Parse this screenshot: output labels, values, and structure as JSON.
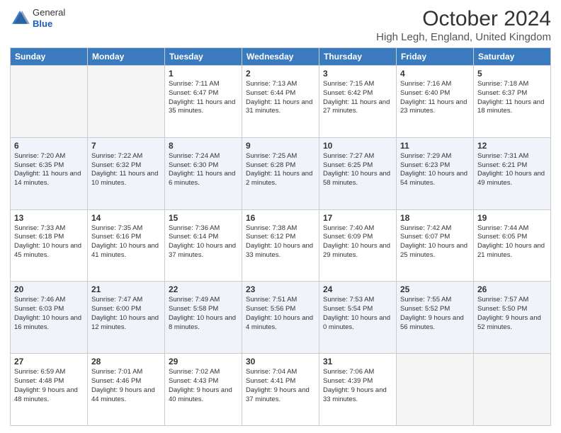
{
  "header": {
    "logo": {
      "general": "General",
      "blue": "Blue"
    },
    "title": "October 2024",
    "subtitle": "High Legh, England, United Kingdom"
  },
  "weekdays": [
    "Sunday",
    "Monday",
    "Tuesday",
    "Wednesday",
    "Thursday",
    "Friday",
    "Saturday"
  ],
  "weeks": [
    [
      {
        "day": "",
        "sunrise": "",
        "sunset": "",
        "daylight": ""
      },
      {
        "day": "",
        "sunrise": "",
        "sunset": "",
        "daylight": ""
      },
      {
        "day": "1",
        "sunrise": "Sunrise: 7:11 AM",
        "sunset": "Sunset: 6:47 PM",
        "daylight": "Daylight: 11 hours and 35 minutes."
      },
      {
        "day": "2",
        "sunrise": "Sunrise: 7:13 AM",
        "sunset": "Sunset: 6:44 PM",
        "daylight": "Daylight: 11 hours and 31 minutes."
      },
      {
        "day": "3",
        "sunrise": "Sunrise: 7:15 AM",
        "sunset": "Sunset: 6:42 PM",
        "daylight": "Daylight: 11 hours and 27 minutes."
      },
      {
        "day": "4",
        "sunrise": "Sunrise: 7:16 AM",
        "sunset": "Sunset: 6:40 PM",
        "daylight": "Daylight: 11 hours and 23 minutes."
      },
      {
        "day": "5",
        "sunrise": "Sunrise: 7:18 AM",
        "sunset": "Sunset: 6:37 PM",
        "daylight": "Daylight: 11 hours and 18 minutes."
      }
    ],
    [
      {
        "day": "6",
        "sunrise": "Sunrise: 7:20 AM",
        "sunset": "Sunset: 6:35 PM",
        "daylight": "Daylight: 11 hours and 14 minutes."
      },
      {
        "day": "7",
        "sunrise": "Sunrise: 7:22 AM",
        "sunset": "Sunset: 6:32 PM",
        "daylight": "Daylight: 11 hours and 10 minutes."
      },
      {
        "day": "8",
        "sunrise": "Sunrise: 7:24 AM",
        "sunset": "Sunset: 6:30 PM",
        "daylight": "Daylight: 11 hours and 6 minutes."
      },
      {
        "day": "9",
        "sunrise": "Sunrise: 7:25 AM",
        "sunset": "Sunset: 6:28 PM",
        "daylight": "Daylight: 11 hours and 2 minutes."
      },
      {
        "day": "10",
        "sunrise": "Sunrise: 7:27 AM",
        "sunset": "Sunset: 6:25 PM",
        "daylight": "Daylight: 10 hours and 58 minutes."
      },
      {
        "day": "11",
        "sunrise": "Sunrise: 7:29 AM",
        "sunset": "Sunset: 6:23 PM",
        "daylight": "Daylight: 10 hours and 54 minutes."
      },
      {
        "day": "12",
        "sunrise": "Sunrise: 7:31 AM",
        "sunset": "Sunset: 6:21 PM",
        "daylight": "Daylight: 10 hours and 49 minutes."
      }
    ],
    [
      {
        "day": "13",
        "sunrise": "Sunrise: 7:33 AM",
        "sunset": "Sunset: 6:18 PM",
        "daylight": "Daylight: 10 hours and 45 minutes."
      },
      {
        "day": "14",
        "sunrise": "Sunrise: 7:35 AM",
        "sunset": "Sunset: 6:16 PM",
        "daylight": "Daylight: 10 hours and 41 minutes."
      },
      {
        "day": "15",
        "sunrise": "Sunrise: 7:36 AM",
        "sunset": "Sunset: 6:14 PM",
        "daylight": "Daylight: 10 hours and 37 minutes."
      },
      {
        "day": "16",
        "sunrise": "Sunrise: 7:38 AM",
        "sunset": "Sunset: 6:12 PM",
        "daylight": "Daylight: 10 hours and 33 minutes."
      },
      {
        "day": "17",
        "sunrise": "Sunrise: 7:40 AM",
        "sunset": "Sunset: 6:09 PM",
        "daylight": "Daylight: 10 hours and 29 minutes."
      },
      {
        "day": "18",
        "sunrise": "Sunrise: 7:42 AM",
        "sunset": "Sunset: 6:07 PM",
        "daylight": "Daylight: 10 hours and 25 minutes."
      },
      {
        "day": "19",
        "sunrise": "Sunrise: 7:44 AM",
        "sunset": "Sunset: 6:05 PM",
        "daylight": "Daylight: 10 hours and 21 minutes."
      }
    ],
    [
      {
        "day": "20",
        "sunrise": "Sunrise: 7:46 AM",
        "sunset": "Sunset: 6:03 PM",
        "daylight": "Daylight: 10 hours and 16 minutes."
      },
      {
        "day": "21",
        "sunrise": "Sunrise: 7:47 AM",
        "sunset": "Sunset: 6:00 PM",
        "daylight": "Daylight: 10 hours and 12 minutes."
      },
      {
        "day": "22",
        "sunrise": "Sunrise: 7:49 AM",
        "sunset": "Sunset: 5:58 PM",
        "daylight": "Daylight: 10 hours and 8 minutes."
      },
      {
        "day": "23",
        "sunrise": "Sunrise: 7:51 AM",
        "sunset": "Sunset: 5:56 PM",
        "daylight": "Daylight: 10 hours and 4 minutes."
      },
      {
        "day": "24",
        "sunrise": "Sunrise: 7:53 AM",
        "sunset": "Sunset: 5:54 PM",
        "daylight": "Daylight: 10 hours and 0 minutes."
      },
      {
        "day": "25",
        "sunrise": "Sunrise: 7:55 AM",
        "sunset": "Sunset: 5:52 PM",
        "daylight": "Daylight: 9 hours and 56 minutes."
      },
      {
        "day": "26",
        "sunrise": "Sunrise: 7:57 AM",
        "sunset": "Sunset: 5:50 PM",
        "daylight": "Daylight: 9 hours and 52 minutes."
      }
    ],
    [
      {
        "day": "27",
        "sunrise": "Sunrise: 6:59 AM",
        "sunset": "Sunset: 4:48 PM",
        "daylight": "Daylight: 9 hours and 48 minutes."
      },
      {
        "day": "28",
        "sunrise": "Sunrise: 7:01 AM",
        "sunset": "Sunset: 4:46 PM",
        "daylight": "Daylight: 9 hours and 44 minutes."
      },
      {
        "day": "29",
        "sunrise": "Sunrise: 7:02 AM",
        "sunset": "Sunset: 4:43 PM",
        "daylight": "Daylight: 9 hours and 40 minutes."
      },
      {
        "day": "30",
        "sunrise": "Sunrise: 7:04 AM",
        "sunset": "Sunset: 4:41 PM",
        "daylight": "Daylight: 9 hours and 37 minutes."
      },
      {
        "day": "31",
        "sunrise": "Sunrise: 7:06 AM",
        "sunset": "Sunset: 4:39 PM",
        "daylight": "Daylight: 9 hours and 33 minutes."
      },
      {
        "day": "",
        "sunrise": "",
        "sunset": "",
        "daylight": ""
      },
      {
        "day": "",
        "sunrise": "",
        "sunset": "",
        "daylight": ""
      }
    ]
  ]
}
